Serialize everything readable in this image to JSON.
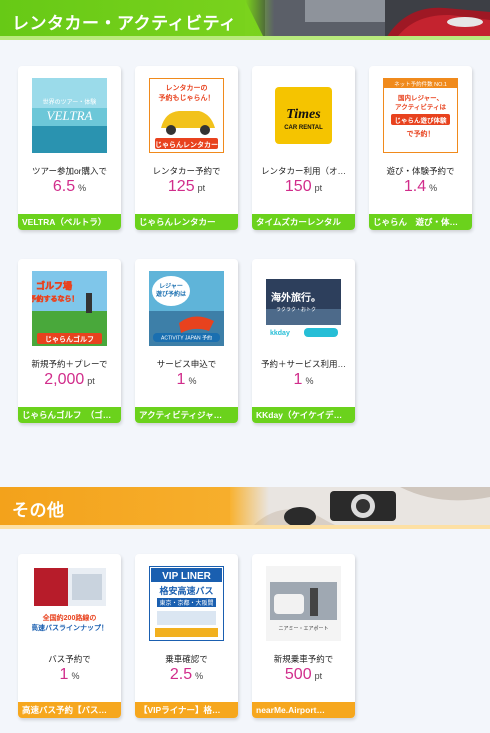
{
  "sections": [
    {
      "title": "レンタカー・アクティビティ",
      "cards": [
        {
          "desc": "ツアー参加or購入で",
          "rate": "6.5",
          "unit": "%",
          "name": "VELTRA（ベルトラ）",
          "thumb_text": "世界のツアー・体験 VELTRA"
        },
        {
          "desc": "レンタカー予約で",
          "rate": "125",
          "unit": "pt",
          "name": "じゃらんレンタカー",
          "thumb_text": "レンタカーの予約もじゃらん！"
        },
        {
          "desc": "レンタカー利用（オ…",
          "rate": "150",
          "unit": "pt",
          "name": "タイムズカーレンタル",
          "thumb_text": "Times CAR RENTAL"
        },
        {
          "desc": "遊び・体験予約で",
          "rate": "1.4",
          "unit": "%",
          "name": "じゃらん　遊び・体…",
          "thumb_text": "国内レジャー、アクティビティは じゃらん遊び体験で予約！"
        },
        {
          "desc": "新規予約＋プレーで",
          "rate": "2,000",
          "unit": "pt",
          "name": "じゃらんゴルフ　（ゴ…",
          "thumb_text": "ゴルフ場予約するなら！"
        },
        {
          "desc": "サービス申込で",
          "rate": "1",
          "unit": "%",
          "name": "アクティビティジャ…",
          "thumb_text": "レジャー遊び予約は アクティビティジャパン"
        },
        {
          "desc": "予約＋サービス利用…",
          "rate": "1",
          "unit": "%",
          "name": "KKday（ケイケイデ…",
          "thumb_text": "海外旅行。ラクラク・おトク kkday"
        }
      ]
    },
    {
      "title": "その他",
      "cards": [
        {
          "desc": "バス予約で",
          "rate": "1",
          "unit": "%",
          "name": "高速バス予約【バス…",
          "thumb_text": "全国約200路線の高速バスラインナップ！"
        },
        {
          "desc": "乗車確認で",
          "rate": "2.5",
          "unit": "%",
          "name": "【VIPライナー】格…",
          "thumb_text": "VIP LINER 格安高速バス 東京・京都・大阪間"
        },
        {
          "desc": "新規乗車予約で",
          "rate": "500",
          "unit": "pt",
          "name": "nearMe.Airport…",
          "thumb_text": "ニアミー・エアポート"
        }
      ]
    }
  ]
}
